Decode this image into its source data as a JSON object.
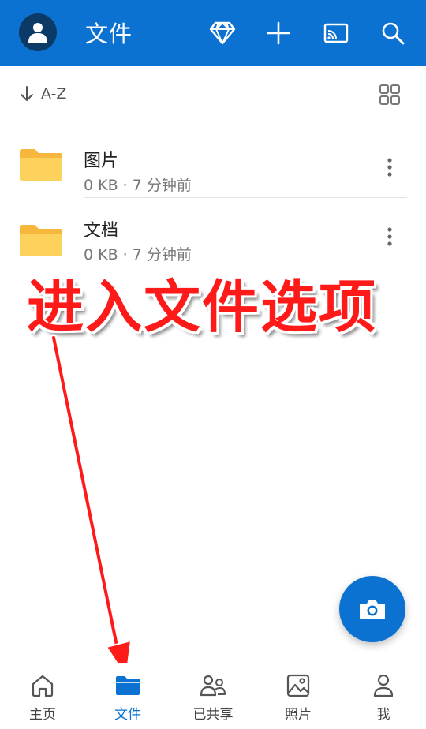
{
  "header": {
    "title": "文件",
    "icons": [
      "premium-diamond-icon",
      "add-icon",
      "cast-icon",
      "search-icon"
    ]
  },
  "sort": {
    "label": "A-Z",
    "direction_icon": "arrow-down-icon",
    "view_icon": "grid-view-icon"
  },
  "files": [
    {
      "name": "图片",
      "meta": "0 KB · 7 分钟前"
    },
    {
      "name": "文档",
      "meta": "0 KB · 7 分钟前"
    }
  ],
  "annotation": {
    "text": "进入文件选项"
  },
  "fab": {
    "icon": "camera-icon"
  },
  "bottom_nav": [
    {
      "label": "主页",
      "icon": "home-icon",
      "active": false
    },
    {
      "label": "文件",
      "icon": "folder-icon",
      "active": true
    },
    {
      "label": "已共享",
      "icon": "people-icon",
      "active": false
    },
    {
      "label": "照片",
      "icon": "image-icon",
      "active": false
    },
    {
      "label": "我",
      "icon": "person-icon",
      "active": false
    }
  ],
  "colors": {
    "accent": "#0c72d2",
    "folder": "#fcd25c",
    "annotation": "#ff1a1a"
  }
}
